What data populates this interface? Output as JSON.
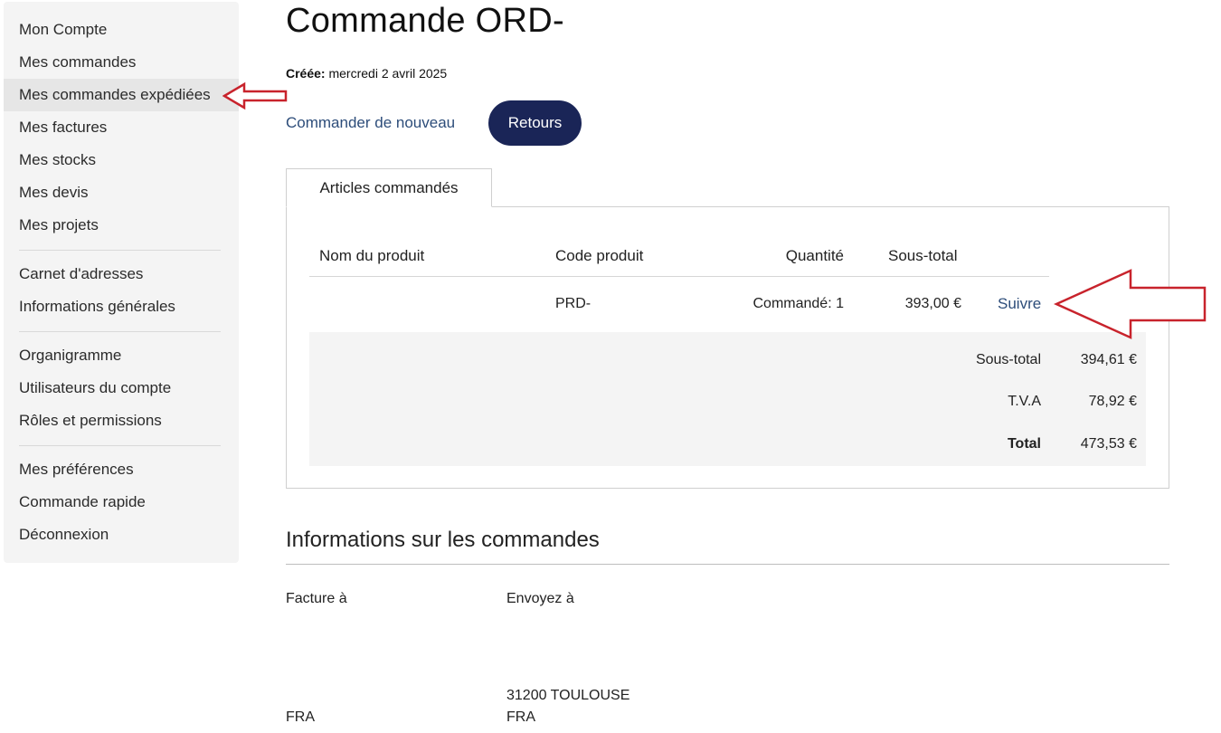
{
  "sidebar": {
    "group1": [
      "Mon Compte",
      "Mes commandes",
      "Mes commandes expédiées",
      "Mes factures",
      "Mes stocks",
      "Mes devis",
      "Mes projets"
    ],
    "group2": [
      "Carnet d'adresses",
      "Informations générales"
    ],
    "group3": [
      "Organigramme",
      "Utilisateurs du compte",
      "Rôles et permissions"
    ],
    "group4": [
      "Mes préférences",
      "Commande rapide",
      "Déconnexion"
    ]
  },
  "order": {
    "title": "Commande ORD-",
    "created_label": "Créée:",
    "created_date": "mercredi 2 avril 2025",
    "reorder_label": "Commander de nouveau",
    "returns_label": "Retours"
  },
  "items_tab": {
    "label": "Articles commandés",
    "columns": {
      "name": "Nom du produit",
      "code": "Code produit",
      "qty": "Quantité",
      "subtotal": "Sous-total"
    },
    "rows": [
      {
        "name": "",
        "code": "PRD-",
        "qty": "Commandé: 1",
        "subtotal": "393,00 €",
        "action": "Suivre"
      }
    ],
    "totals": [
      {
        "label": "Sous-total",
        "value": "394,61 €"
      },
      {
        "label": "T.V.A",
        "value": "78,92 €"
      },
      {
        "label": "Total",
        "value": "473,53 €"
      }
    ]
  },
  "info": {
    "title": "Informations sur les commandes",
    "bill_to_label": "Facture à",
    "ship_to_label": "Envoyez à",
    "bill_to_country": "FRA",
    "ship_to_city": "31200 TOULOUSE",
    "ship_to_country": "FRA"
  },
  "colors": {
    "accent": "#1a2557",
    "link": "#2d4d7a",
    "annotation": "#c8232c"
  }
}
